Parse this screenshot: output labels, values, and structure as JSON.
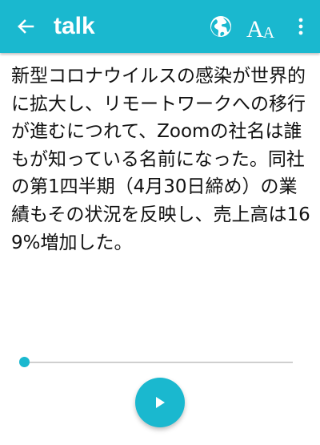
{
  "app_bar": {
    "title": "talk",
    "back_icon": "arrow-left-icon",
    "language_icon": "globe-icon",
    "font_size_icon": "font-size-icon",
    "font_size_big": "A",
    "font_size_small": "A",
    "more_icon": "more-vertical-icon"
  },
  "article": {
    "text": "新型コロナウイルスの感染が世界的に拡大し、リモートワークへの移行が進むにつれて、Zoomの社名は誰もが知っている名前になった。同社の第1四半期（4月30日締め）の業績もその状況を反映し、売上高は169%増加した。"
  },
  "player": {
    "progress": 0.0,
    "play_icon": "play-icon"
  },
  "colors": {
    "accent": "#1ab8cf",
    "text": "#111111",
    "track": "#cfcfcf"
  }
}
